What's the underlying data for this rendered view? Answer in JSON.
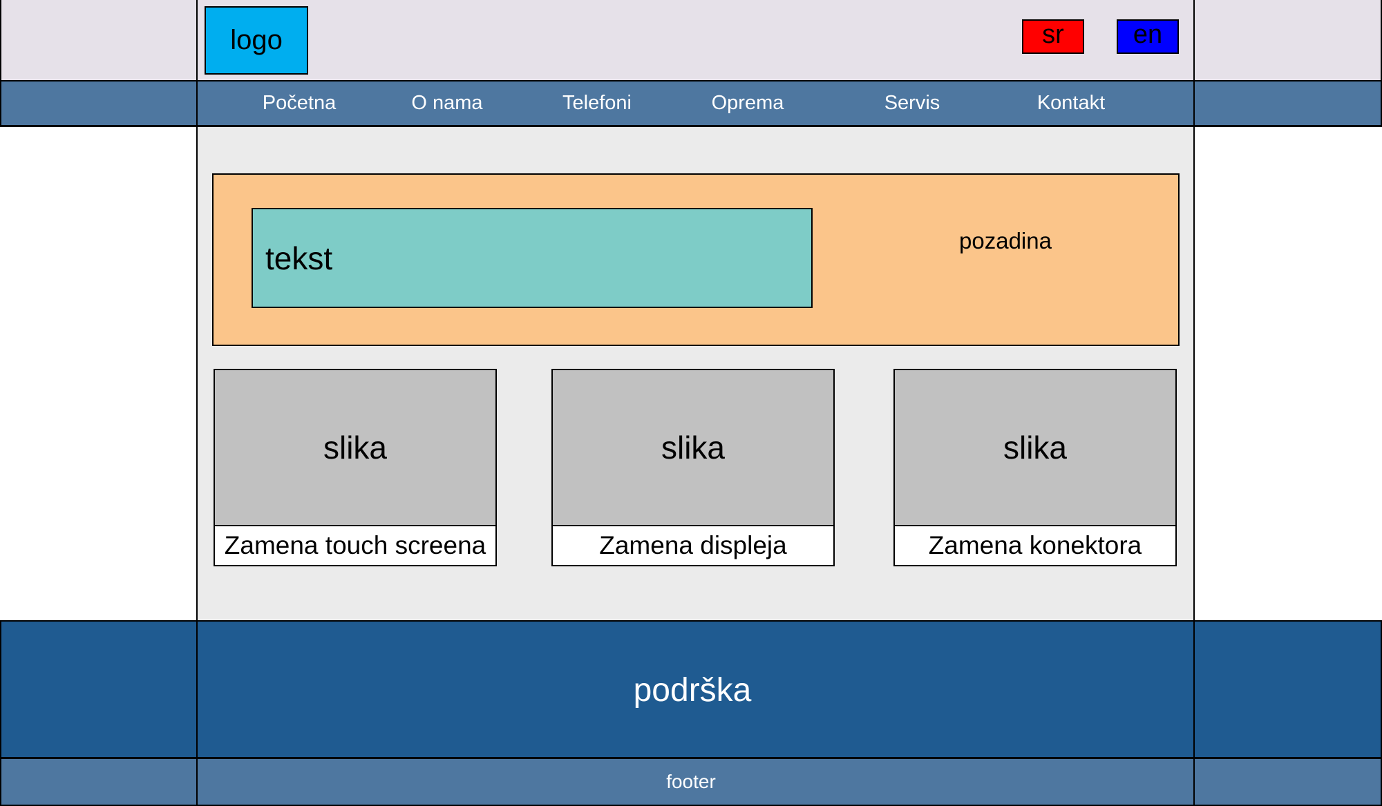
{
  "header": {
    "logo_label": "logo",
    "languages": [
      {
        "label": "sr",
        "color": "#ff0000"
      },
      {
        "label": "en",
        "color": "#0000ff"
      }
    ]
  },
  "nav": {
    "items": [
      {
        "label": "Početna"
      },
      {
        "label": "O nama"
      },
      {
        "label": "Telefoni"
      },
      {
        "label": "Oprema"
      },
      {
        "label": "Servis"
      },
      {
        "label": "Kontakt"
      }
    ]
  },
  "hero": {
    "text_label": "tekst",
    "background_label": "pozadina"
  },
  "cards": [
    {
      "image_label": "slika",
      "caption": "Zamena touch screena"
    },
    {
      "image_label": "slika",
      "caption": "Zamena displeja"
    },
    {
      "image_label": "slika",
      "caption": "Zamena konektora"
    }
  ],
  "support": {
    "label": "podrška"
  },
  "footer": {
    "label": "footer"
  },
  "colors": {
    "header_bg": "#e6e1e9",
    "nav_bg": "#4e77a0",
    "main_bg": "#ebebeb",
    "hero_bg": "#fbc58a",
    "hero_text_bg": "#7eccc7",
    "logo_bg": "#00aeef",
    "card_image_bg": "#c1c1c1",
    "support_bg": "#1f5b91",
    "footer_bg": "#4e77a0"
  }
}
